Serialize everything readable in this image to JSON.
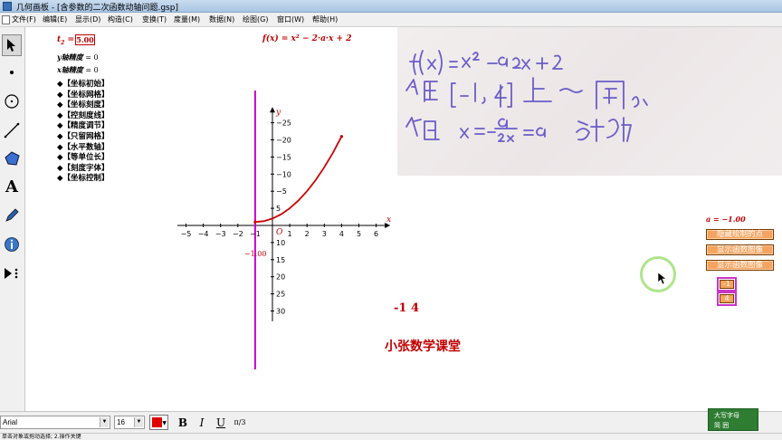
{
  "window": {
    "title": "几何画板 - [含参数的二次函数动轴问题.gsp]"
  },
  "menu": {
    "items": [
      "文件(F)",
      "编辑(E)",
      "显示(D)",
      "构造(C)",
      "变换(T)",
      "度量(M)",
      "数据(N)",
      "绘图(G)",
      "窗口(W)",
      "帮助(H)"
    ]
  },
  "tools": {
    "items": [
      "arrow-select-tool",
      "point-tool",
      "compass-tool",
      "straightedge-tool",
      "polygon-tool",
      "text-tool",
      "marker-tool",
      "info-tool",
      "custom-tool"
    ],
    "text_tool_glyph": "A"
  },
  "canvas": {
    "t2_label": "t",
    "t2_sub": "2",
    "t2_eq": " =",
    "t2_value": "5.00",
    "y_precision_label": "y轴精度",
    "y_precision_value": "= 0",
    "x_precision_label": "x轴精度",
    "x_precision_value": "= 0",
    "control_items": [
      "◆【坐标初始】",
      "◆【坐标网格】",
      "◆【坐标刻度】",
      "◆【控刻度线】",
      "◆【精度调节】",
      "◆【只留网格】",
      "◆【水平数轴】",
      "◆【等单位长】",
      "◆【刻度字体】",
      "◆【坐标控制】"
    ],
    "function_label": "f(x) = x² − 2·a·x + 2",
    "a_label": "a = −1.00",
    "buttons": [
      "隐藏绘制的点",
      "显示函数图像",
      "显示函数图像"
    ],
    "small_buttons": [
      "-1",
      "4"
    ],
    "interval_text": "-1   4",
    "footer_text": "小张数学课堂"
  },
  "axes": {
    "x_axis_label": "x",
    "y_axis_label": "y",
    "origin_label": "O",
    "x_ticks": [
      "−5",
      "−4",
      "−3",
      "−2",
      "−1",
      "1",
      "2",
      "3",
      "4",
      "5",
      "6"
    ],
    "y_ticks": [
      "30",
      "25",
      "20",
      "15",
      "10",
      "5",
      "−5",
      "−10",
      "−15",
      "−20",
      "−25"
    ],
    "vline_label": "−1.00"
  },
  "chart_data": {
    "type": "line",
    "title": "f(x) = x² − 2·a·x + 2",
    "xlabel": "x",
    "ylabel": "y",
    "xlim": [
      -5.5,
      6.5
    ],
    "ylim": [
      -28,
      33
    ],
    "x_ticks": [
      -5,
      -4,
      -3,
      -2,
      -1,
      1,
      2,
      3,
      4,
      5,
      6
    ],
    "y_ticks": [
      -25,
      -20,
      -15,
      -10,
      -5,
      5,
      10,
      15,
      20,
      25,
      30
    ],
    "grid": false,
    "parameter_a": -1.0,
    "series": [
      {
        "x": [
          -1,
          -0.5,
          0,
          0.5,
          1,
          1.5,
          2,
          2.5,
          3,
          3.5,
          4
        ],
        "y": [
          1,
          1.25,
          2,
          3.25,
          5,
          7.25,
          10,
          13.25,
          17,
          21.25,
          26
        ]
      }
    ],
    "vertical_line_x": -1.0,
    "colors": {
      "curve": "#cc0000",
      "vertical_line": "#cc00cc",
      "axes": "#000000"
    }
  },
  "fontbar": {
    "font_name": "Arial",
    "font_size": "16",
    "bold": "B",
    "italic": "I",
    "underline": "U",
    "math_format": "π/3"
  },
  "ime": {
    "row1": "大写字母",
    "row2": "简 囲"
  },
  "status": {
    "text": "单击对象或拖动选择; 2.操作关键"
  }
}
